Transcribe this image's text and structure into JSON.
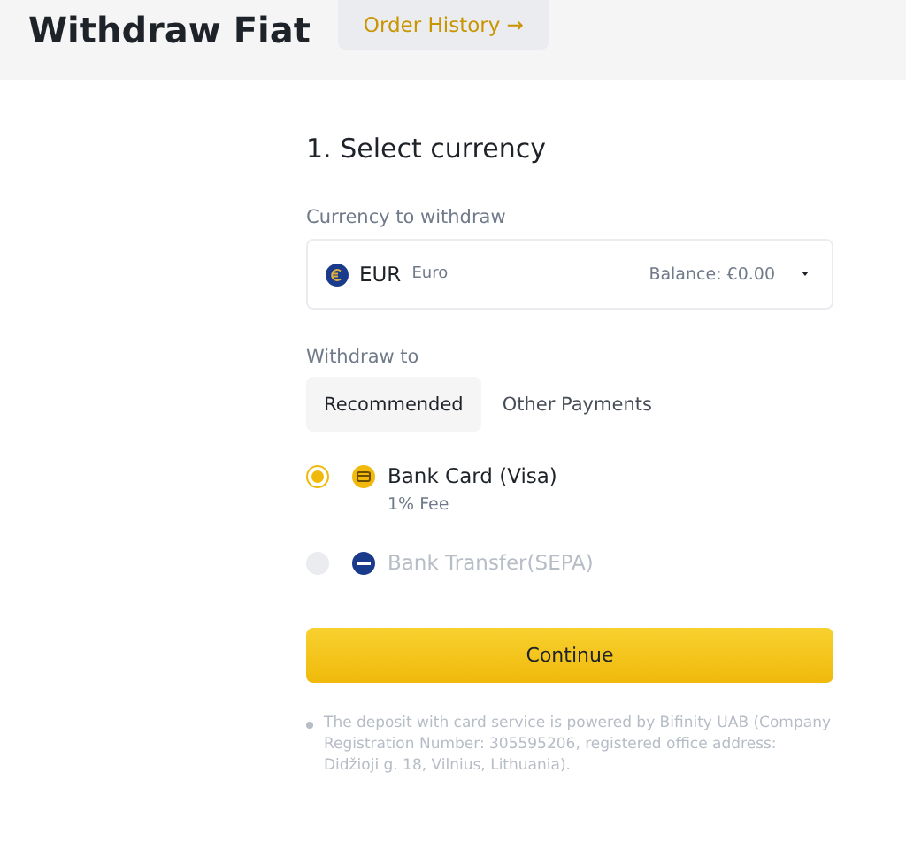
{
  "header": {
    "title": "Withdraw Fiat",
    "order_history_button": "Order History →"
  },
  "step_title": "1. Select currency",
  "currency": {
    "label": "Currency to withdraw",
    "code": "EUR",
    "name": "Euro",
    "balance": "Balance: €0.00"
  },
  "withdraw_to": {
    "label": "Withdraw to",
    "tabs": [
      {
        "label": "Recommended",
        "selected": true
      },
      {
        "label": "Other Payments",
        "selected": false
      }
    ]
  },
  "methods": [
    {
      "kind": "card",
      "name": "Bank Card (Visa)",
      "fee": "1% Fee",
      "selected": true,
      "disabled": false
    },
    {
      "kind": "sepa",
      "name": "Bank Transfer(SEPA)",
      "selected": false,
      "disabled": true
    }
  ],
  "continue_button": "Continue",
  "note": "The deposit with card service is powered by Bifinity UAB (Company Registration Number: 305595206, registered office address: Didžioji g. 18, Vilnius, Lithuania)."
}
